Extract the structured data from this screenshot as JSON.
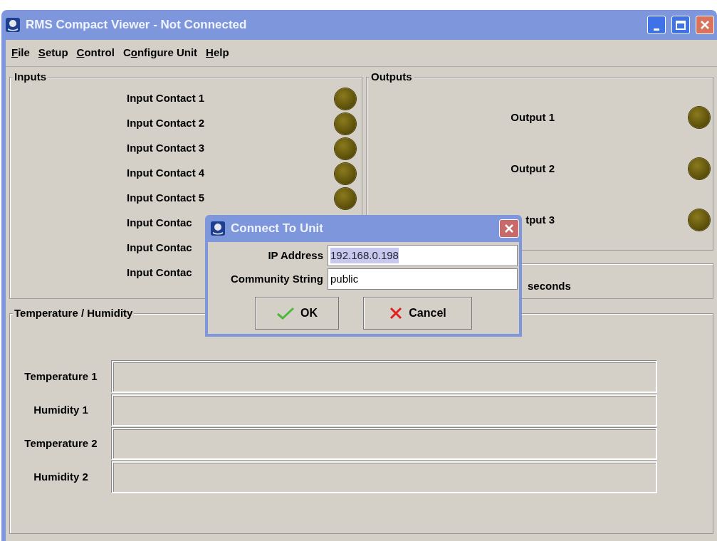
{
  "window": {
    "title": "RMS Compact Viewer - Not Connected"
  },
  "menu": [
    {
      "key": "F",
      "after": "ile"
    },
    {
      "key": "S",
      "after": "etup"
    },
    {
      "key": "C",
      "after": "ontrol"
    },
    {
      "before": "C",
      "key": "o",
      "after": "nfigure Unit"
    },
    {
      "key": "H",
      "after": "elp"
    }
  ],
  "inputs": {
    "title": "Inputs",
    "items": [
      {
        "label": "Input Contact 1",
        "indicator": true
      },
      {
        "label": "Input Contact 2",
        "indicator": true
      },
      {
        "label": "Input Contact 3",
        "indicator": true
      },
      {
        "label": "Input Contact 4",
        "indicator": true
      },
      {
        "label": "Input Contact 5",
        "indicator": true
      },
      {
        "label": "Input Contac",
        "indicator": false
      },
      {
        "label": "Input Contac",
        "indicator": false
      },
      {
        "label": "Input Contac",
        "indicator": false
      }
    ]
  },
  "outputs": {
    "title": "Outputs",
    "items": [
      {
        "label": "Output 1"
      },
      {
        "label": "Output 2"
      },
      {
        "label": "tput 3"
      }
    ]
  },
  "timer_panel": {
    "unit": "seconds"
  },
  "sensors": {
    "title": "Temperature / Humidity",
    "rows": [
      {
        "label": "Temperature 1"
      },
      {
        "label": "Humidity 1"
      },
      {
        "label": "Temperature 2"
      },
      {
        "label": "Humidity 2"
      }
    ]
  },
  "dialog": {
    "title": "Connect To Unit",
    "fields": [
      {
        "label": "IP Address",
        "value": "192.168.0.198",
        "selected": true
      },
      {
        "label": "Community String",
        "value": "public",
        "selected": false
      }
    ],
    "buttons": [
      {
        "label": "OK",
        "kind": "ok"
      },
      {
        "label": "Cancel",
        "kind": "cancel"
      }
    ]
  }
}
